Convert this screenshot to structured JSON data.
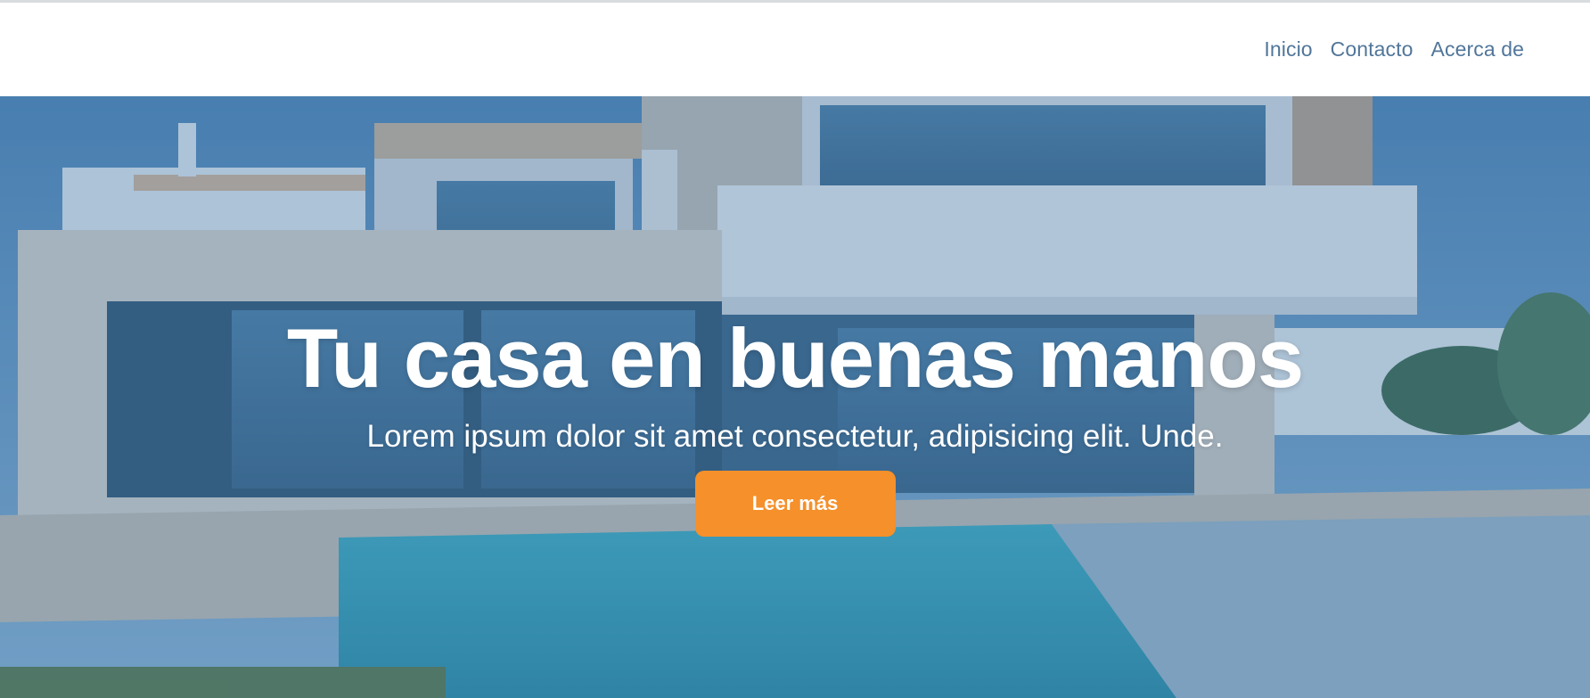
{
  "nav": {
    "links": [
      "Inicio",
      "Contacto",
      "Acerca de"
    ]
  },
  "hero": {
    "title": "Tu casa en buenas manos",
    "subtitle": "Lorem ipsum dolor sit amet consectetur, adipisicing elit. Unde.",
    "button_label": "Leer más"
  },
  "colors": {
    "nav_link": "#51769a",
    "button": "#f5902a",
    "overlay": "#3c6ea0"
  }
}
